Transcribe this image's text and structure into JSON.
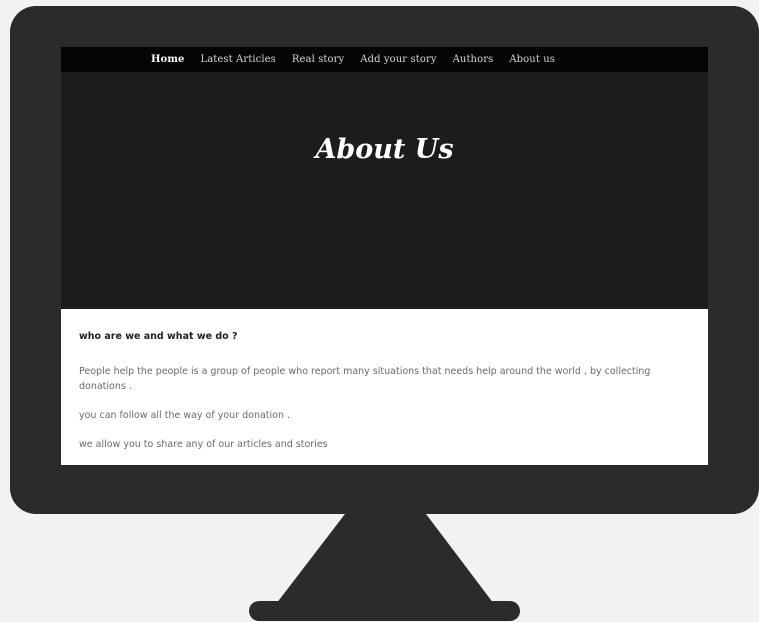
{
  "nav": {
    "items": [
      {
        "label": "Home",
        "active": true
      },
      {
        "label": "Latest Articles",
        "active": false
      },
      {
        "label": "Real story",
        "active": false
      },
      {
        "label": "Add your story",
        "active": false
      },
      {
        "label": "Authors",
        "active": false
      },
      {
        "label": "About us",
        "active": false
      }
    ]
  },
  "hero": {
    "title": "About Us"
  },
  "content": {
    "heading": "who are we and what we do ?",
    "paragraphs": [
      "People help the people is a group of people who report many situations that needs help around the world , by collecting donations .",
      "you can follow all the way of your donation .",
      "we allow you to share any of our articles and stories"
    ]
  },
  "colors": {
    "monitor": "#2b2b2b",
    "navbar": "#050505",
    "hero": "#1c1c1c",
    "body": "#ffffff"
  }
}
